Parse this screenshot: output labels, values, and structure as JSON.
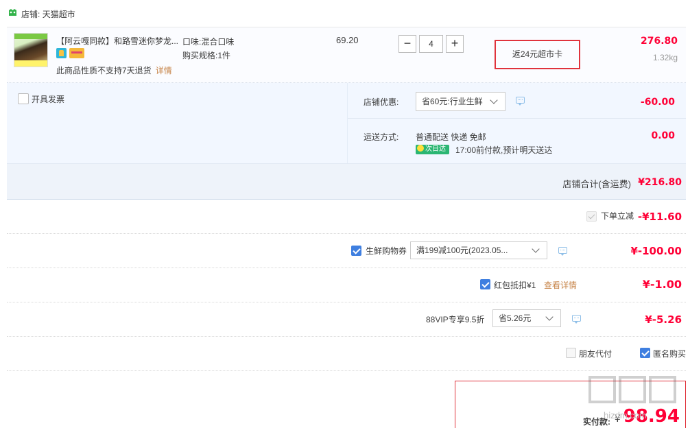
{
  "shop": {
    "label": "店铺:",
    "name": "天猫超市"
  },
  "item": {
    "title": "【阿云嘎同款】和路雪迷你梦龙...",
    "flavor": "口味:混合口味",
    "spec": "购买规格:1件",
    "no_return": "此商品性质不支持7天退货",
    "detail_link": "详情",
    "unit_price": "69.20",
    "quantity": "4",
    "minus": "−",
    "plus": "+",
    "cashback": "返24元超市卡",
    "total": "276.80",
    "weight": "1.32kg"
  },
  "options": {
    "invoice_label": "开具发票",
    "store_discount_label": "店铺优惠:",
    "store_discount_value": "省60元:行业生鲜",
    "store_discount_amount": "-60.00",
    "shipping_label": "运送方式:",
    "shipping_method": "普通配送 快递 免邮",
    "nextday_badge": "次日达",
    "shipping_note": "17:00前付款,预计明天送达",
    "shipping_amount": "0.00"
  },
  "shop_total": {
    "label": "店铺合计(含运费)",
    "amount": "¥216.80"
  },
  "discounts": {
    "instant": {
      "label": "下单立减",
      "amount": "-¥11.60"
    },
    "fresh_coupon": {
      "label": "生鲜购物券",
      "value": "满199减100元(2023.05...",
      "amount": "¥-100.00"
    },
    "red_packet": {
      "label": "红包抵扣¥1",
      "link": "查看详情",
      "amount": "¥-1.00"
    },
    "vip": {
      "label": "88VIP专享9.5折",
      "value": "省5.26元",
      "amount": "¥-5.26"
    },
    "friend_pay": "朋友代付",
    "anonymous": "匿名购买"
  },
  "payment": {
    "label": "实付款:",
    "currency": "¥",
    "amount": "98.94"
  },
  "watermark": "hizdm.com",
  "colors": {
    "price_red": "#ff0036",
    "checkbox_blue": "#3f7fe0",
    "highlight_border": "#e0333c",
    "link_orange": "#c7854a"
  }
}
